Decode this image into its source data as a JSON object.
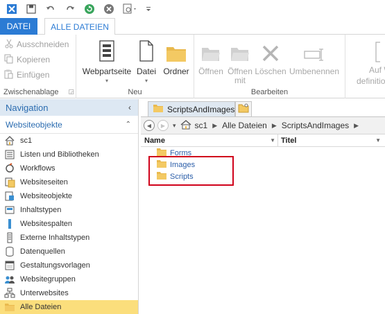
{
  "colors": {
    "accent": "#2b7bd4",
    "nav_header_bg": "#dde8f3",
    "selected_bg": "#fbde7c",
    "highlight_border": "#d0021b",
    "folder": "#e9b94e"
  },
  "qat": {
    "icons": [
      "tools-icon",
      "save-icon",
      "undo-icon",
      "redo-icon",
      "refresh-icon",
      "stop-icon",
      "preview-icon",
      "customize-icon"
    ]
  },
  "tabs": {
    "file": "DATEI",
    "all_files": "ALLE DATEIEN"
  },
  "ribbon": {
    "clipboard": {
      "label": "Zwischenablage",
      "cut": "Ausschneiden",
      "copy": "Kopieren",
      "paste": "Einfügen"
    },
    "new": {
      "label": "Neu",
      "webpart_page": "Webpartseite",
      "file": "Datei",
      "folder": "Ordner"
    },
    "edit": {
      "label": "Bearbeiten",
      "open": "Öffnen",
      "open_with_1": "Öffnen",
      "open_with_2": "mit",
      "delete": "Löschen",
      "rename": "Umbenennen"
    },
    "partial": {
      "line1": "Auf W",
      "line2": "definition"
    }
  },
  "nav": {
    "header": "Navigation",
    "section": "Websiteobjekte",
    "items": [
      {
        "label": "sc1",
        "icon": "home-icon"
      },
      {
        "label": "Listen und Bibliotheken",
        "icon": "list-icon"
      },
      {
        "label": "Workflows",
        "icon": "workflow-icon"
      },
      {
        "label": "Websiteseiten",
        "icon": "pages-icon"
      },
      {
        "label": "Websiteobjekte",
        "icon": "assets-icon"
      },
      {
        "label": "Inhaltstypen",
        "icon": "content-types-icon"
      },
      {
        "label": "Websitespalten",
        "icon": "columns-icon"
      },
      {
        "label": "Externe Inhaltstypen",
        "icon": "external-content-icon"
      },
      {
        "label": "Datenquellen",
        "icon": "database-icon"
      },
      {
        "label": "Gestaltungsvorlagen",
        "icon": "master-page-icon"
      },
      {
        "label": "Websitegruppen",
        "icon": "groups-icon"
      },
      {
        "label": "Unterwebsites",
        "icon": "subsites-icon"
      },
      {
        "label": "Alle Dateien",
        "icon": "folder-icon"
      }
    ]
  },
  "content": {
    "tab_title": "ScriptsAndImages",
    "breadcrumb": [
      "sc1",
      "Alle Dateien",
      "ScriptsAndImages"
    ],
    "columns": {
      "name": "Name",
      "title": "Titel"
    },
    "rows": [
      "Forms",
      "Images",
      "Scripts"
    ]
  }
}
